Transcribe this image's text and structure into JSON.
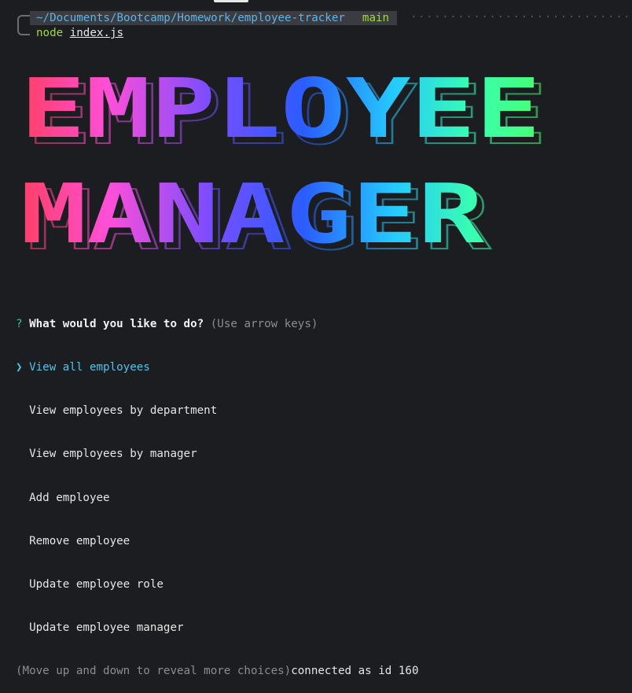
{
  "terminal": {
    "path": "~/Documents/Bootcamp/Homework/employee-tracker",
    "branch": "main",
    "command_prefix": "node",
    "command_arg": "index.js"
  },
  "banner": {
    "line1": "EMPLOYEE",
    "line2": "MANAGER",
    "gradient": [
      "#ff3b4a",
      "#ff4fd8",
      "#7b4dff",
      "#2b5cff",
      "#25c8ff",
      "#39ffb0",
      "#4dff5a"
    ]
  },
  "prompt": {
    "marker": "?",
    "question": "What would you like to do?",
    "hint": "(Use arrow keys)",
    "pointer": "❯",
    "selected": "View all employees",
    "options": [
      "View employees by department",
      "View employees by manager",
      "Add employee",
      "Remove employee",
      "Update employee role",
      "Update employee manager"
    ],
    "footer": "(Move up and down to reveal more choices)",
    "status": "connected as id 160"
  },
  "colors": {
    "background": "#1c1d21",
    "path": "#5fb3e6",
    "branch": "#9fd93a",
    "question_marker": "#3fbf8f",
    "selected": "#4fc3e8"
  }
}
